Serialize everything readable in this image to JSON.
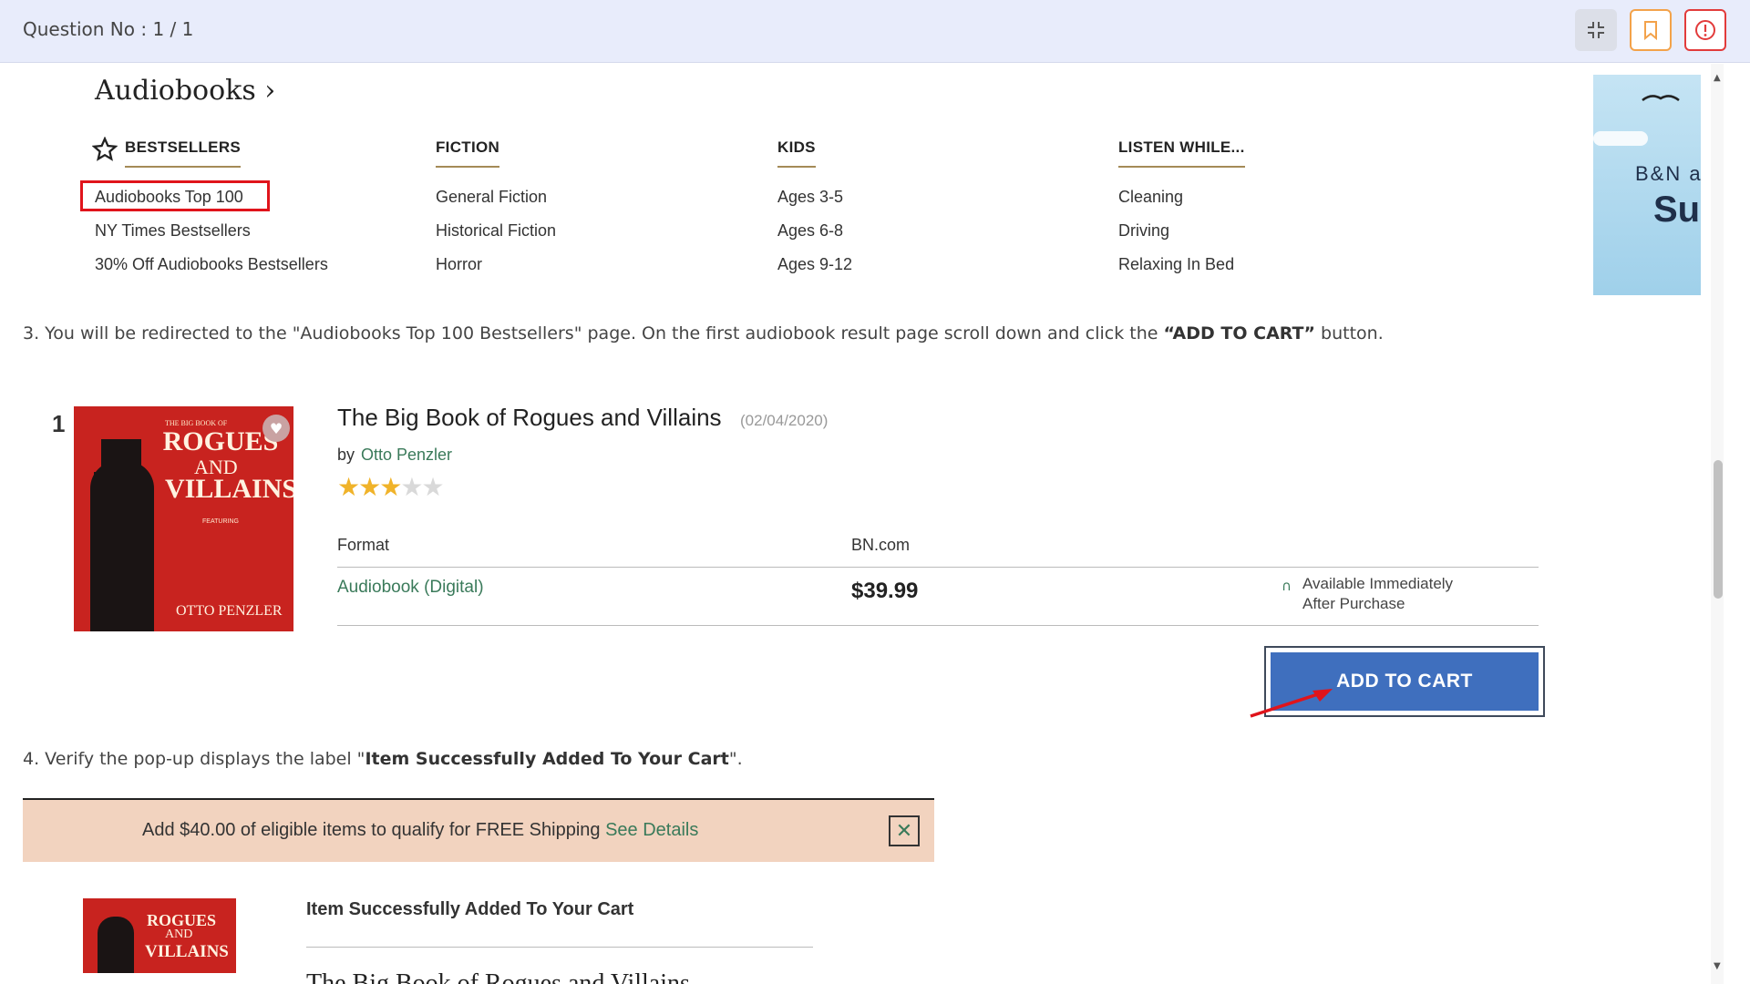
{
  "header": {
    "question_label": "Question No : 1 / 1",
    "icons": [
      "shrink-icon",
      "bookmark-icon",
      "report-icon"
    ]
  },
  "audiobooks_menu": {
    "title": "Audiobooks",
    "columns": [
      {
        "heading": "BESTSELLERS",
        "links": [
          "Audiobooks Top 100",
          "NY Times Bestsellers",
          "30% Off Audiobooks Bestsellers"
        ]
      },
      {
        "heading": "FICTION",
        "links": [
          "General Fiction",
          "Historical Fiction",
          "Horror"
        ]
      },
      {
        "heading": "KIDS",
        "links": [
          "Ages 3-5",
          "Ages 6-8",
          "Ages 9-12"
        ]
      },
      {
        "heading": "LISTEN WHILE...",
        "links": [
          "Cleaning",
          "Driving",
          "Relaxing In Bed"
        ]
      }
    ],
    "ad": {
      "brand": "B&N a",
      "big": "Sul"
    }
  },
  "step3": {
    "prefix": "3. You will be redirected to the \"Audiobooks Top 100 Bestsellers\" page. On the first audiobook result page scroll down and click the ",
    "bold": "“ADD TO CART”",
    "suffix": " button."
  },
  "product": {
    "rank": "1",
    "title": "The Big Book of Rogues and Villains",
    "date": "(02/04/2020)",
    "by": "by",
    "author": "Otto Penzler",
    "rating": 3,
    "rating_max": 5,
    "format_header": "Format",
    "seller_header": "BN.com",
    "format": "Audiobook (Digital)",
    "price": "$39.99",
    "availability_line1": "Available Immediately",
    "availability_line2": "After Purchase",
    "add_to_cart": "ADD TO CART",
    "cover": {
      "top_line": "THE BIG BOOK OF",
      "rogues": "ROGUES",
      "and": "AND",
      "villains": "VILLAINS",
      "featuring": "FEATURING",
      "author": "OTTO PENZLER"
    }
  },
  "step4": {
    "prefix": "4. Verify the pop-up displays the label \"",
    "bold": "Item Successfully Added To Your Cart",
    "suffix": "\"."
  },
  "popup": {
    "banner_text": "Add $40.00 of eligible items to qualify for FREE Shipping ",
    "banner_link": "See Details",
    "close_glyph": "✕",
    "message": "Item Successfully Added To Your Cart",
    "cover": {
      "rogues": "ROGUES",
      "and": "AND",
      "villains": "VILLAINS"
    },
    "cut_title": "The Big Book of Rogues and Villains"
  },
  "colors": {
    "accent_blue": "#3f6fbe",
    "link_green": "#3a7a5a",
    "highlight_red": "#e0141b",
    "star": "#f0b32a"
  }
}
